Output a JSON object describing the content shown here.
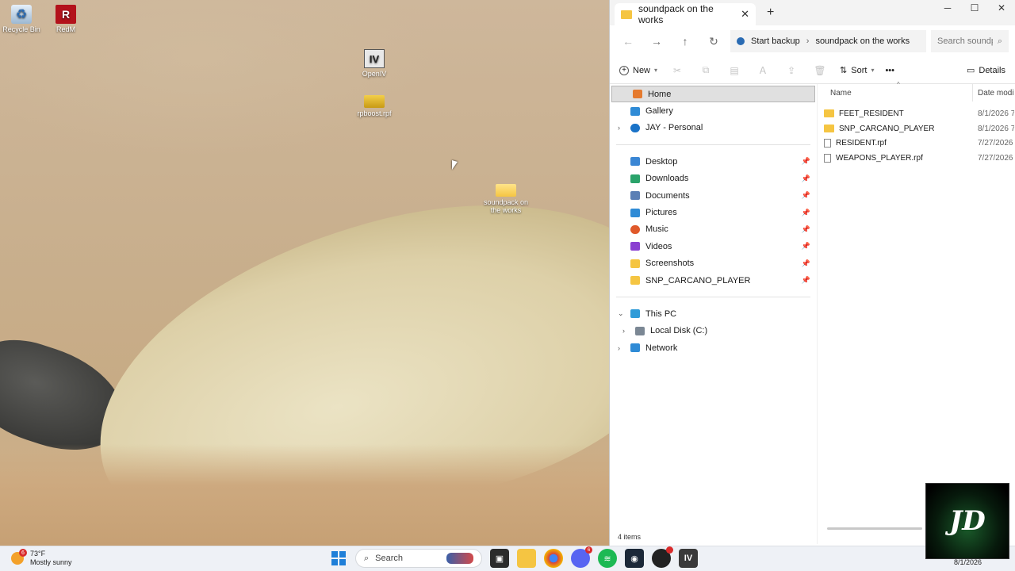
{
  "desktop": {
    "icons": [
      {
        "label": "Recycle Bin",
        "icon": "recycle-bin-icon"
      },
      {
        "label": "RedM",
        "icon": "redm-icon"
      },
      {
        "label": "OpenIV",
        "icon": "openiv-icon"
      },
      {
        "label": "rpboost.rpf",
        "icon": "rpf-file-icon"
      },
      {
        "label": "soundpack on the works",
        "icon": "folder-icon"
      }
    ]
  },
  "explorer": {
    "tab_title": "soundpack on the works",
    "window_controls": {
      "minimize": "─",
      "maximize": "☐",
      "close": "✕"
    },
    "address": {
      "backup_label": "Start backup",
      "separator": "›",
      "current": "soundpack on the works"
    },
    "search_placeholder": "Search soundpack on the works",
    "toolbar": {
      "new_label": "New",
      "sort_label": "Sort",
      "more_label": "•••",
      "details_label": "Details"
    },
    "nav": {
      "top": [
        {
          "label": "Home",
          "selected": true
        },
        {
          "label": "Gallery"
        },
        {
          "label": "JAY - Personal",
          "expandable": true
        }
      ],
      "quick": [
        {
          "label": "Desktop",
          "color": "#3a86d4"
        },
        {
          "label": "Downloads",
          "color": "#2aa36a"
        },
        {
          "label": "Documents",
          "color": "#5b7fb5"
        },
        {
          "label": "Pictures",
          "color": "#2f8bd6"
        },
        {
          "label": "Music",
          "color": "#e0592a"
        },
        {
          "label": "Videos",
          "color": "#8a3fd1"
        },
        {
          "label": "Screenshots",
          "color": "#f5c542"
        },
        {
          "label": "SNP_CARCANO_PLAYER",
          "color": "#f5c542"
        }
      ],
      "pc": [
        {
          "label": "This PC",
          "expanded": true
        },
        {
          "label": "Local Disk (C:)"
        },
        {
          "label": "Network"
        }
      ]
    },
    "columns": {
      "name": "Name",
      "date": "Date modified"
    },
    "files": [
      {
        "name": "FEET_RESIDENT",
        "type": "folder",
        "date": "8/1/2026 7:"
      },
      {
        "name": "SNP_CARCANO_PLAYER",
        "type": "folder",
        "date": "8/1/2026 7:"
      },
      {
        "name": "RESIDENT.rpf",
        "type": "file",
        "date": "7/27/2026 1"
      },
      {
        "name": "WEAPONS_PLAYER.rpf",
        "type": "file",
        "date": "7/27/2026 1"
      }
    ],
    "status": "4 items"
  },
  "webcam_overlay": "JD",
  "taskbar": {
    "weather": {
      "temp": "73°F",
      "condition": "Mostly sunny",
      "badge": "6"
    },
    "search_placeholder": "Search",
    "discord_badge": "6",
    "date": "8/1/2026",
    "colors": {
      "accent": "#1f7fd8"
    }
  }
}
